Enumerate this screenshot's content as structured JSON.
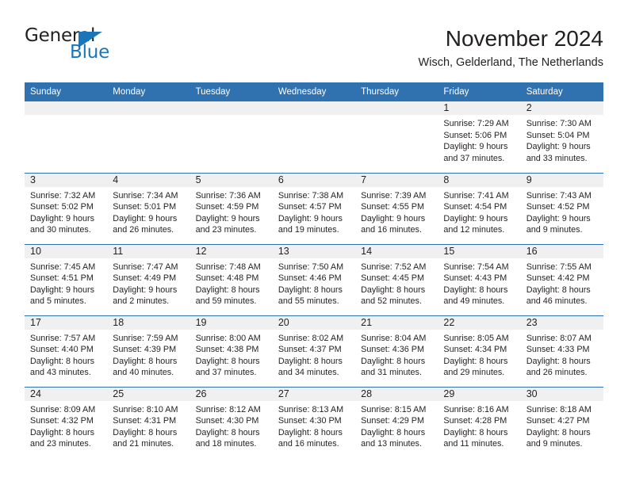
{
  "brand": {
    "name_top": "General",
    "name_bottom": "Blue",
    "triangle_color": "#1b75bb",
    "text_color_top": "#231f20",
    "text_color_bottom": "#1b75bb"
  },
  "header": {
    "title": "November 2024",
    "subtitle": "Wisch, Gelderland, The Netherlands"
  },
  "colors": {
    "header_blue": "#3071b0",
    "daynum_band": "#f0f0f0",
    "text": "#231f20"
  },
  "weekdays": [
    "Sunday",
    "Monday",
    "Tuesday",
    "Wednesday",
    "Thursday",
    "Friday",
    "Saturday"
  ],
  "weeks": [
    [
      {
        "day": "",
        "sunrise": "",
        "sunset": "",
        "daylight_line1": "",
        "daylight_line2": ""
      },
      {
        "day": "",
        "sunrise": "",
        "sunset": "",
        "daylight_line1": "",
        "daylight_line2": ""
      },
      {
        "day": "",
        "sunrise": "",
        "sunset": "",
        "daylight_line1": "",
        "daylight_line2": ""
      },
      {
        "day": "",
        "sunrise": "",
        "sunset": "",
        "daylight_line1": "",
        "daylight_line2": ""
      },
      {
        "day": "",
        "sunrise": "",
        "sunset": "",
        "daylight_line1": "",
        "daylight_line2": ""
      },
      {
        "day": "1",
        "sunrise": "Sunrise: 7:29 AM",
        "sunset": "Sunset: 5:06 PM",
        "daylight_line1": "Daylight: 9 hours",
        "daylight_line2": "and 37 minutes."
      },
      {
        "day": "2",
        "sunrise": "Sunrise: 7:30 AM",
        "sunset": "Sunset: 5:04 PM",
        "daylight_line1": "Daylight: 9 hours",
        "daylight_line2": "and 33 minutes."
      }
    ],
    [
      {
        "day": "3",
        "sunrise": "Sunrise: 7:32 AM",
        "sunset": "Sunset: 5:02 PM",
        "daylight_line1": "Daylight: 9 hours",
        "daylight_line2": "and 30 minutes."
      },
      {
        "day": "4",
        "sunrise": "Sunrise: 7:34 AM",
        "sunset": "Sunset: 5:01 PM",
        "daylight_line1": "Daylight: 9 hours",
        "daylight_line2": "and 26 minutes."
      },
      {
        "day": "5",
        "sunrise": "Sunrise: 7:36 AM",
        "sunset": "Sunset: 4:59 PM",
        "daylight_line1": "Daylight: 9 hours",
        "daylight_line2": "and 23 minutes."
      },
      {
        "day": "6",
        "sunrise": "Sunrise: 7:38 AM",
        "sunset": "Sunset: 4:57 PM",
        "daylight_line1": "Daylight: 9 hours",
        "daylight_line2": "and 19 minutes."
      },
      {
        "day": "7",
        "sunrise": "Sunrise: 7:39 AM",
        "sunset": "Sunset: 4:55 PM",
        "daylight_line1": "Daylight: 9 hours",
        "daylight_line2": "and 16 minutes."
      },
      {
        "day": "8",
        "sunrise": "Sunrise: 7:41 AM",
        "sunset": "Sunset: 4:54 PM",
        "daylight_line1": "Daylight: 9 hours",
        "daylight_line2": "and 12 minutes."
      },
      {
        "day": "9",
        "sunrise": "Sunrise: 7:43 AM",
        "sunset": "Sunset: 4:52 PM",
        "daylight_line1": "Daylight: 9 hours",
        "daylight_line2": "and 9 minutes."
      }
    ],
    [
      {
        "day": "10",
        "sunrise": "Sunrise: 7:45 AM",
        "sunset": "Sunset: 4:51 PM",
        "daylight_line1": "Daylight: 9 hours",
        "daylight_line2": "and 5 minutes."
      },
      {
        "day": "11",
        "sunrise": "Sunrise: 7:47 AM",
        "sunset": "Sunset: 4:49 PM",
        "daylight_line1": "Daylight: 9 hours",
        "daylight_line2": "and 2 minutes."
      },
      {
        "day": "12",
        "sunrise": "Sunrise: 7:48 AM",
        "sunset": "Sunset: 4:48 PM",
        "daylight_line1": "Daylight: 8 hours",
        "daylight_line2": "and 59 minutes."
      },
      {
        "day": "13",
        "sunrise": "Sunrise: 7:50 AM",
        "sunset": "Sunset: 4:46 PM",
        "daylight_line1": "Daylight: 8 hours",
        "daylight_line2": "and 55 minutes."
      },
      {
        "day": "14",
        "sunrise": "Sunrise: 7:52 AM",
        "sunset": "Sunset: 4:45 PM",
        "daylight_line1": "Daylight: 8 hours",
        "daylight_line2": "and 52 minutes."
      },
      {
        "day": "15",
        "sunrise": "Sunrise: 7:54 AM",
        "sunset": "Sunset: 4:43 PM",
        "daylight_line1": "Daylight: 8 hours",
        "daylight_line2": "and 49 minutes."
      },
      {
        "day": "16",
        "sunrise": "Sunrise: 7:55 AM",
        "sunset": "Sunset: 4:42 PM",
        "daylight_line1": "Daylight: 8 hours",
        "daylight_line2": "and 46 minutes."
      }
    ],
    [
      {
        "day": "17",
        "sunrise": "Sunrise: 7:57 AM",
        "sunset": "Sunset: 4:40 PM",
        "daylight_line1": "Daylight: 8 hours",
        "daylight_line2": "and 43 minutes."
      },
      {
        "day": "18",
        "sunrise": "Sunrise: 7:59 AM",
        "sunset": "Sunset: 4:39 PM",
        "daylight_line1": "Daylight: 8 hours",
        "daylight_line2": "and 40 minutes."
      },
      {
        "day": "19",
        "sunrise": "Sunrise: 8:00 AM",
        "sunset": "Sunset: 4:38 PM",
        "daylight_line1": "Daylight: 8 hours",
        "daylight_line2": "and 37 minutes."
      },
      {
        "day": "20",
        "sunrise": "Sunrise: 8:02 AM",
        "sunset": "Sunset: 4:37 PM",
        "daylight_line1": "Daylight: 8 hours",
        "daylight_line2": "and 34 minutes."
      },
      {
        "day": "21",
        "sunrise": "Sunrise: 8:04 AM",
        "sunset": "Sunset: 4:36 PM",
        "daylight_line1": "Daylight: 8 hours",
        "daylight_line2": "and 31 minutes."
      },
      {
        "day": "22",
        "sunrise": "Sunrise: 8:05 AM",
        "sunset": "Sunset: 4:34 PM",
        "daylight_line1": "Daylight: 8 hours",
        "daylight_line2": "and 29 minutes."
      },
      {
        "day": "23",
        "sunrise": "Sunrise: 8:07 AM",
        "sunset": "Sunset: 4:33 PM",
        "daylight_line1": "Daylight: 8 hours",
        "daylight_line2": "and 26 minutes."
      }
    ],
    [
      {
        "day": "24",
        "sunrise": "Sunrise: 8:09 AM",
        "sunset": "Sunset: 4:32 PM",
        "daylight_line1": "Daylight: 8 hours",
        "daylight_line2": "and 23 minutes."
      },
      {
        "day": "25",
        "sunrise": "Sunrise: 8:10 AM",
        "sunset": "Sunset: 4:31 PM",
        "daylight_line1": "Daylight: 8 hours",
        "daylight_line2": "and 21 minutes."
      },
      {
        "day": "26",
        "sunrise": "Sunrise: 8:12 AM",
        "sunset": "Sunset: 4:30 PM",
        "daylight_line1": "Daylight: 8 hours",
        "daylight_line2": "and 18 minutes."
      },
      {
        "day": "27",
        "sunrise": "Sunrise: 8:13 AM",
        "sunset": "Sunset: 4:30 PM",
        "daylight_line1": "Daylight: 8 hours",
        "daylight_line2": "and 16 minutes."
      },
      {
        "day": "28",
        "sunrise": "Sunrise: 8:15 AM",
        "sunset": "Sunset: 4:29 PM",
        "daylight_line1": "Daylight: 8 hours",
        "daylight_line2": "and 13 minutes."
      },
      {
        "day": "29",
        "sunrise": "Sunrise: 8:16 AM",
        "sunset": "Sunset: 4:28 PM",
        "daylight_line1": "Daylight: 8 hours",
        "daylight_line2": "and 11 minutes."
      },
      {
        "day": "30",
        "sunrise": "Sunrise: 8:18 AM",
        "sunset": "Sunset: 4:27 PM",
        "daylight_line1": "Daylight: 8 hours",
        "daylight_line2": "and 9 minutes."
      }
    ]
  ]
}
